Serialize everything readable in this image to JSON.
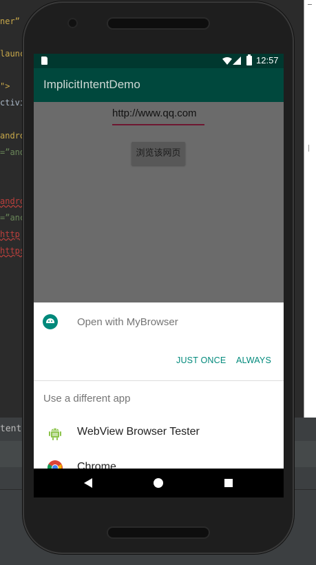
{
  "ide": {
    "code_fragments": [
      "nerˮ",
      "launc",
      "\">",
      "ctivi",
      "andro",
      "=ˮand",
      "andro",
      "=ˮanc",
      "http",
      "https"
    ],
    "bottom_tab": "tent-"
  },
  "status_bar": {
    "time": "12:57",
    "icons": [
      "sd-card-icon",
      "wifi-icon",
      "signal-icon",
      "battery-icon"
    ]
  },
  "app_bar": {
    "title": "ImplicitIntentDemo"
  },
  "form": {
    "url_value": "http://www.qq.com",
    "browse_button": "浏览该网页"
  },
  "chooser": {
    "open_with_label": "Open with MyBrowser",
    "just_once_button": "JUST ONCE",
    "always_button": "ALWAYS",
    "section_label": "Use a different app",
    "apps": [
      {
        "name": "WebView Browser Tester",
        "icon": "android-robot-icon"
      },
      {
        "name": "Chrome",
        "icon": "chrome-icon"
      }
    ]
  },
  "nav_bar": {
    "buttons": [
      "back-icon",
      "home-icon",
      "recents-icon"
    ]
  },
  "colors": {
    "status_bar": "#00382f",
    "app_bar": "#00483d",
    "accent": "#00897b",
    "url_underline": "#6e1630",
    "scrim": "#6b6b6b"
  }
}
